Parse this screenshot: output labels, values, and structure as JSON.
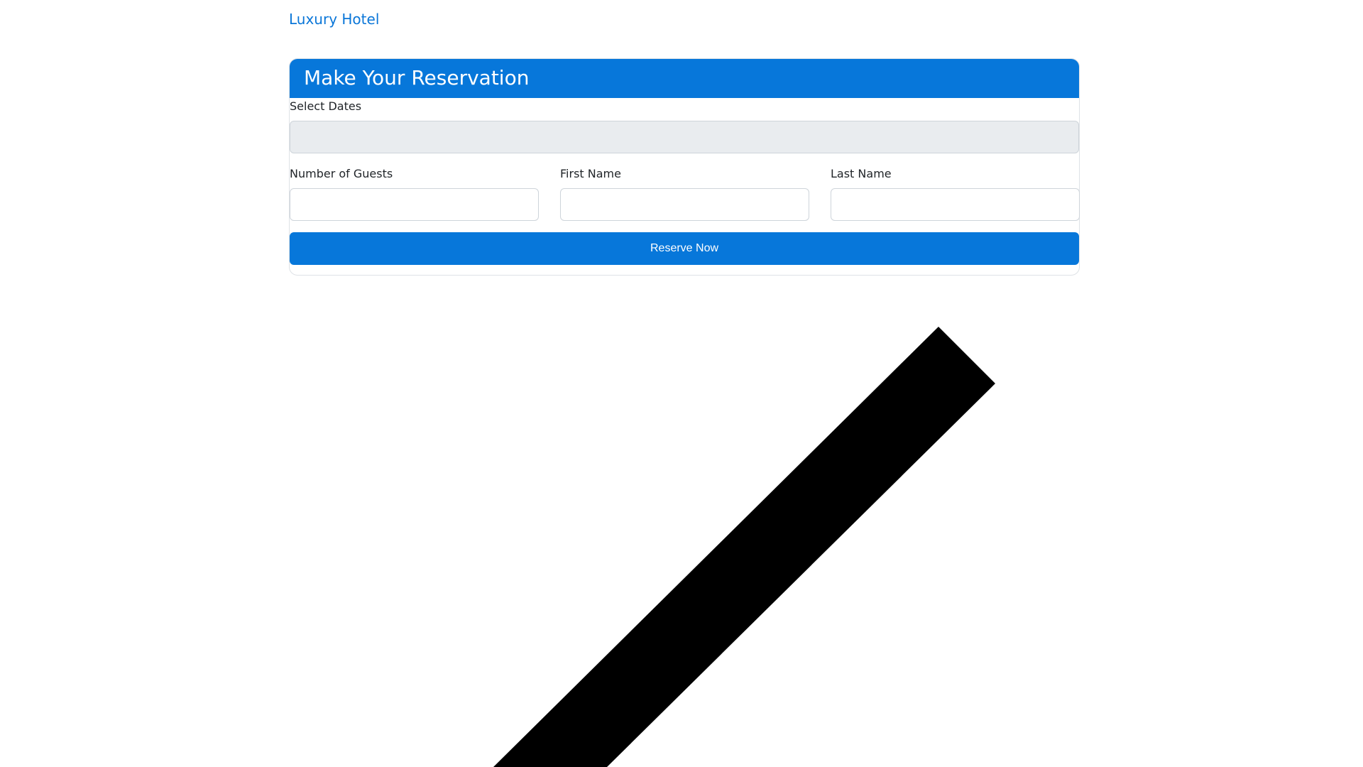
{
  "header": {
    "brand": "Luxury Hotel"
  },
  "reservation": {
    "title": "Make Your Reservation",
    "dates": {
      "label": "Select Dates",
      "value": ""
    },
    "guests": {
      "label": "Number of Guests",
      "value": ""
    },
    "first_name": {
      "label": "First Name",
      "value": ""
    },
    "last_name": {
      "label": "Last Name",
      "value": ""
    },
    "submit_label": "Reserve Now"
  },
  "colors": {
    "accent": "#0777da",
    "brand_link": "#0a76d8",
    "readonly_field": "#e9ecef",
    "decor_shape": "#000000"
  }
}
